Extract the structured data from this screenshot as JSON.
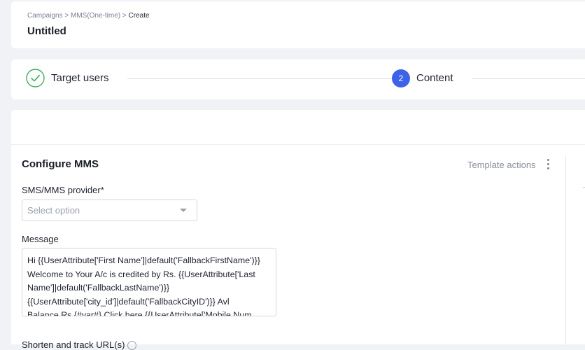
{
  "breadcrumb": {
    "items": [
      "Campaigns",
      "MMS(One-time)"
    ],
    "separator": ">",
    "current": "Create"
  },
  "page": {
    "title": "Untitled"
  },
  "steps": [
    {
      "label": "Target users",
      "status": "completed",
      "icon": "check-circle-icon"
    },
    {
      "label": "Content",
      "status": "active",
      "number": "2"
    }
  ],
  "configure": {
    "title": "Configure MMS",
    "template_actions": "Template actions",
    "provider": {
      "label": "SMS/MMS provider*",
      "placeholder": "Select option"
    },
    "message": {
      "label": "Message",
      "lines": [
        "Hi {{UserAttribute['First Name']|default('FallbackFirstName')}}",
        "Welcome to Your A/c is credited by Rs. {{UserAttribute['Last",
        "Name']|default('FallbackLastName')}}",
        "{{UserAttribute['city_id']|default('FallbackCityID')}} Avl",
        "Balance Rs {#var#} Click here {{UserAttribute['Mobile Num..."
      ]
    },
    "short_url_label": "Shorten and track URL(s)"
  },
  "colors": {
    "accent": "#3d63e9",
    "success": "#3fae5c",
    "background": "#f1f2f5"
  }
}
